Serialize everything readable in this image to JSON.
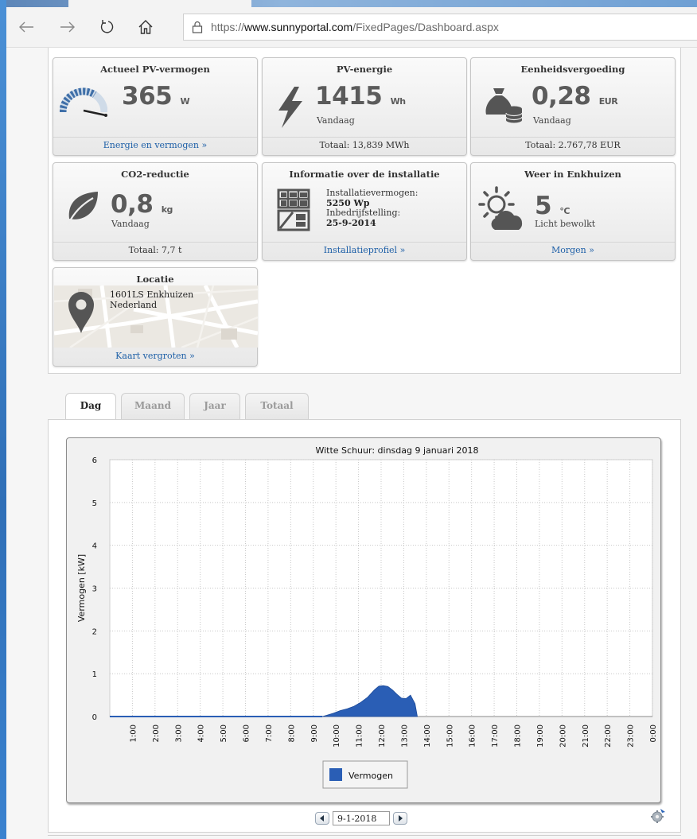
{
  "browser": {
    "url_prefix": "https://",
    "url_domain": "www.sunnyportal.com",
    "url_path": "/FixedPages/Dashboard.aspx"
  },
  "tiles": {
    "pv_power": {
      "title": "Actueel PV-vermogen",
      "value": "365",
      "unit": "W",
      "footer": "Energie en vermogen »"
    },
    "pv_energy": {
      "title": "PV-energie",
      "value": "1415",
      "unit": "Wh",
      "sub": "Vandaag",
      "footer": "Totaal: 13,839 MWh"
    },
    "feed_in": {
      "title": "Eenheidsvergoeding",
      "value": "0,28",
      "unit": "EUR",
      "sub": "Vandaag",
      "footer": "Totaal: 2.767,78 EUR"
    },
    "co2": {
      "title": "CO2-reductie",
      "value": "0,8",
      "unit": "kg",
      "sub": "Vandaag",
      "footer": "Totaal: 7,7 t"
    },
    "installation": {
      "title": "Informatie over de installatie",
      "capacity_label": "Installatievermogen:",
      "capacity_value": "5250 Wp",
      "commission_label": "Inbedrijfstelling:",
      "commission_value": "25-9-2014",
      "footer": "Installatieprofiel »"
    },
    "weather": {
      "title": "Weer in Enkhuizen",
      "value": "5",
      "unit": "°C",
      "sub": "Licht bewolkt",
      "footer": "Morgen »"
    },
    "location": {
      "title": "Locatie",
      "address_line1": "1601LS Enkhuizen",
      "address_line2": "Nederland",
      "footer": "Kaart vergroten »"
    }
  },
  "tabs": [
    {
      "label": "Dag",
      "active": true
    },
    {
      "label": "Maand",
      "active": false
    },
    {
      "label": "Jaar",
      "active": false
    },
    {
      "label": "Totaal",
      "active": false
    }
  ],
  "date_nav": {
    "value": "9-1-2018"
  },
  "colors": {
    "series": "#2a5eb5",
    "link": "#1d5fa7"
  },
  "chart_data": {
    "type": "area",
    "title": "Witte Schuur: dinsdag 9 januari 2018",
    "xlabel": "",
    "ylabel": "Vermogen [kW]",
    "ylim": [
      0,
      6
    ],
    "yticks": [
      "0",
      "1",
      "2",
      "3",
      "4",
      "5",
      "6"
    ],
    "categories": [
      "1:00",
      "2:00",
      "3:00",
      "4:00",
      "5:00",
      "6:00",
      "7:00",
      "8:00",
      "9:00",
      "10:00",
      "11:00",
      "12:00",
      "13:00",
      "14:00",
      "15:00",
      "16:00",
      "17:00",
      "18:00",
      "19:00",
      "20:00",
      "21:00",
      "22:00",
      "23:00",
      "0:00"
    ],
    "grid": true,
    "legend": "bottom-center",
    "series": [
      {
        "name": "Vermogen",
        "x": [
          0,
          9.4,
          9.6,
          9.9,
          10.2,
          10.5,
          10.8,
          11.1,
          11.4,
          11.7,
          11.9,
          12.1,
          12.3,
          12.5,
          12.7,
          12.9,
          13.1,
          13.3,
          13.5,
          13.6
        ],
        "y": [
          0,
          0,
          0.03,
          0.08,
          0.14,
          0.18,
          0.24,
          0.33,
          0.45,
          0.62,
          0.71,
          0.72,
          0.7,
          0.62,
          0.52,
          0.43,
          0.42,
          0.5,
          0.3,
          0
        ]
      }
    ]
  }
}
